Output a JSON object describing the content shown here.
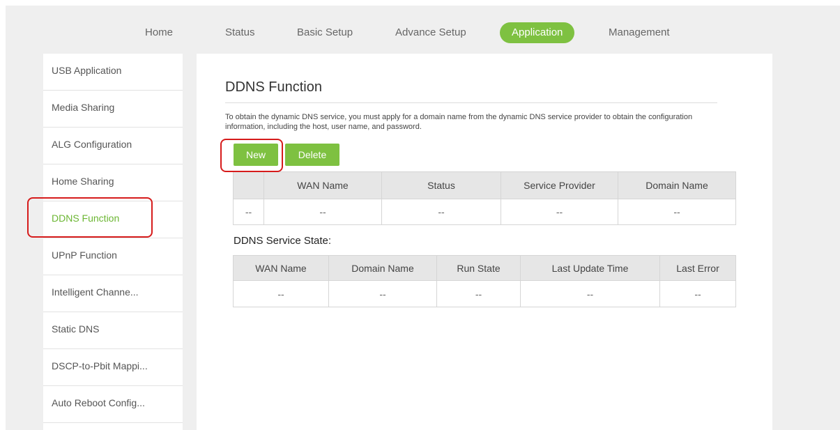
{
  "topnav": {
    "items": [
      "Home",
      "Status",
      "Basic Setup",
      "Advance Setup",
      "Application",
      "Management"
    ],
    "active": "Application"
  },
  "sidebar": {
    "items": [
      "USB Application",
      "Media Sharing",
      "ALG Configuration",
      "Home Sharing",
      "DDNS Function",
      "UPnP Function",
      "Intelligent Channe...",
      "Static DNS",
      "DSCP-to-Pbit Mappi...",
      "Auto Reboot Config..."
    ],
    "active": "DDNS Function"
  },
  "main": {
    "title": "DDNS Function",
    "description": "To obtain the dynamic DNS service, you must apply for a domain name from the dynamic DNS service provider to obtain the configuration information, including the host, user name, and password.",
    "new_label": "New",
    "delete_label": "Delete",
    "ddns_table": {
      "headers": [
        "",
        "WAN Name",
        "Status",
        "Service Provider",
        "Domain Name"
      ],
      "row": [
        "--",
        "--",
        "--",
        "--",
        "--"
      ]
    },
    "state_label": "DDNS Service State:",
    "state_table": {
      "headers": [
        "WAN Name",
        "Domain Name",
        "Run State",
        "Last Update Time",
        "Last Error"
      ],
      "row": [
        "--",
        "--",
        "--",
        "--",
        "--"
      ]
    }
  },
  "colors": {
    "accent": "#7ec141",
    "highlight": "#d61b1b",
    "page_background": "#efefef"
  }
}
